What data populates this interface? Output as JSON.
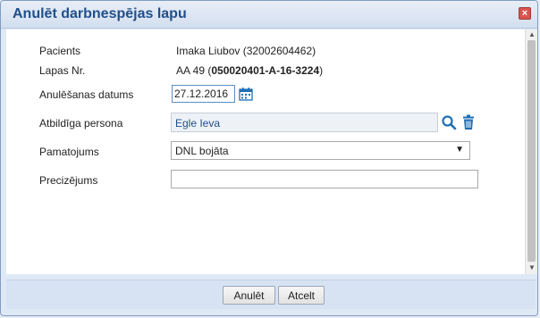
{
  "window": {
    "title": "Anulēt darbnespējas lapu",
    "close_symbol": "×"
  },
  "form": {
    "patient_label": "Pacients",
    "patient_value": "Imaka Liubov (32002604462)",
    "sheet_label": "Lapas Nr.",
    "sheet_prefix": "AA 49 (",
    "sheet_code": "050020401-A-16-3224",
    "sheet_suffix": ")",
    "annul_date_label": "Anulēšanas datums",
    "annul_date_value": "27.12.2016",
    "person_label": "Atbildīga persona",
    "person_value": "Egle Ieva",
    "reason_label": "Pamatojums",
    "reason_selected": "DNL bojāta",
    "clarification_label": "Precizējums",
    "clarification_value": ""
  },
  "icons": {
    "calendar": "calendar-icon",
    "search": "search-icon",
    "trash": "trash-icon",
    "close": "close-icon"
  },
  "buttons": {
    "annul": "Anulēt",
    "cancel": "Atcelt"
  },
  "colors": {
    "title": "#1f4f8d",
    "accent": "#1f6fb5",
    "close": "#d9534f"
  }
}
